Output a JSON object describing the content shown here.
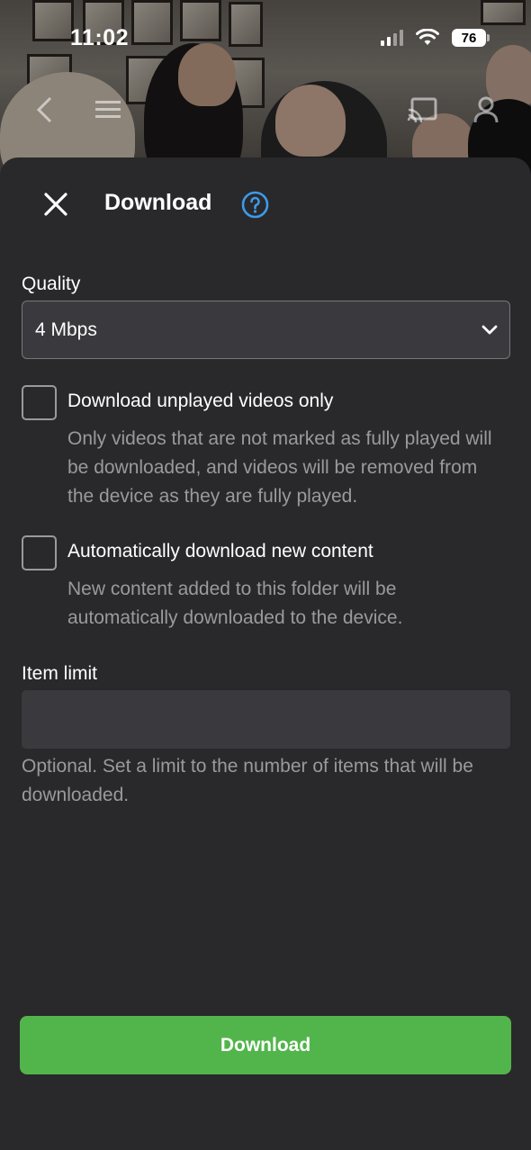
{
  "status_bar": {
    "time": "11:02",
    "battery": "76"
  },
  "header": {
    "title": "Download",
    "close_icon": "close-icon",
    "help_icon": "help-circle-icon"
  },
  "quality": {
    "label": "Quality",
    "selected": "4 Mbps"
  },
  "options": [
    {
      "label": "Download unplayed videos only",
      "description": "Only videos that are not marked as fully played will be downloaded, and videos will be removed from the device as they are fully played.",
      "checked": false
    },
    {
      "label": "Automatically download new content",
      "description": "New content added to this folder will be automatically downloaded to the device.",
      "checked": false
    }
  ],
  "item_limit": {
    "label": "Item limit",
    "value": "",
    "helper": "Optional. Set a limit to the number of items that will be downloaded."
  },
  "actions": {
    "download_label": "Download"
  },
  "colors": {
    "accent": "#52b54b",
    "help": "#3d9be9",
    "sheet": "#29292b"
  }
}
